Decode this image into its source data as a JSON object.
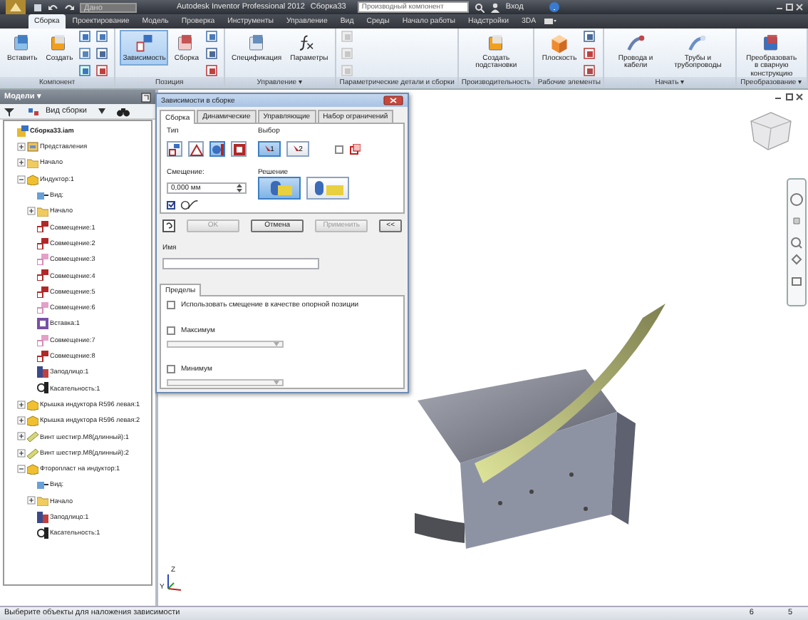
{
  "title_bar": {
    "quick_dropdown": "Дано",
    "app_title": "Autodesk Inventor Professional 2012",
    "document": "Сборка33",
    "search": {
      "placeholder": "Производный компонент"
    },
    "sign_in": "Вход"
  },
  "ribbon_tabs": [
    {
      "label": "Сборка",
      "selected": true
    },
    {
      "label": "Проектирование",
      "selected": false
    },
    {
      "label": "Модель",
      "selected": false
    },
    {
      "label": "Проверка",
      "selected": false
    },
    {
      "label": "Инструменты",
      "selected": false
    },
    {
      "label": "Управление",
      "selected": false
    },
    {
      "label": "Вид",
      "selected": false
    },
    {
      "label": "Среды",
      "selected": false
    },
    {
      "label": "Начало работы",
      "selected": false
    },
    {
      "label": "Надстройки",
      "selected": false
    },
    {
      "label": "3DA",
      "selected": false
    }
  ],
  "ribbon_groups": [
    {
      "label": "Компонент",
      "buttons": [
        {
          "label": "Вставить",
          "kind": "insert",
          "selected": false
        },
        {
          "label": "Создать",
          "kind": "create",
          "selected": false
        }
      ]
    },
    {
      "label": "Позиция",
      "buttons": [
        {
          "label": "Зависимость",
          "kind": "constraint",
          "selected": true
        },
        {
          "label": "Сборка",
          "kind": "assemble",
          "selected": false
        }
      ]
    },
    {
      "label": "Управление ▾",
      "buttons": [
        {
          "label": "Спецификация",
          "kind": "bom",
          "selected": false
        },
        {
          "label": "Параметры",
          "kind": "fx",
          "selected": false
        }
      ]
    },
    {
      "label": "Параметрические детали и сборки"
    },
    {
      "label": "Производительность",
      "buttons": [
        {
          "label": "Создать подстановки",
          "kind": "substitute",
          "selected": false
        }
      ]
    },
    {
      "label": "Рабочие элементы",
      "buttons": [
        {
          "label": "Плоскость",
          "kind": "plane",
          "selected": false
        }
      ]
    },
    {
      "label": "Начать ▾",
      "buttons": [
        {
          "label": "Провода и кабели",
          "kind": "cable",
          "selected": false
        },
        {
          "label": "Трубы и трубопроводы",
          "kind": "tube",
          "selected": false
        }
      ]
    },
    {
      "label": "Преобразование ▾",
      "buttons": [
        {
          "label": "Преобразовать в сварную конструкцию",
          "kind": "weld",
          "selected": false
        }
      ]
    }
  ],
  "browser": {
    "title": "Модели ▾",
    "view_dropdown": "Вид сборки",
    "tree": [
      {
        "label": "Сборка33.iam",
        "kind": "assembly",
        "children": [
          {
            "label": "Представления",
            "kind": "views",
            "expanded": false
          },
          {
            "label": "Начало",
            "kind": "folder",
            "expanded": false
          },
          {
            "label": "Индуктор:1",
            "kind": "part",
            "expanded": true,
            "children": [
              {
                "label": "Вид:",
                "kind": "view"
              },
              {
                "label": "Начало",
                "kind": "folder",
                "expanded": false
              },
              {
                "label": "Совмещение:1",
                "kind": "mate"
              },
              {
                "label": "Совмещение:2",
                "kind": "mate"
              },
              {
                "label": "Совмещение:3",
                "kind": "mate-off"
              },
              {
                "label": "Совмещение:4",
                "kind": "mate"
              },
              {
                "label": "Совмещение:5",
                "kind": "mate"
              },
              {
                "label": "Совмещение:6",
                "kind": "mate-off"
              },
              {
                "label": "Вставка:1",
                "kind": "insert"
              },
              {
                "label": "Совмещение:7",
                "kind": "mate-off"
              },
              {
                "label": "Совмещение:8",
                "kind": "mate"
              },
              {
                "label": "Заподлицо:1",
                "kind": "flush"
              },
              {
                "label": "Касательность:1",
                "kind": "tangent"
              }
            ]
          },
          {
            "label": "Крышка индуктора R596 левая:1",
            "kind": "part",
            "expanded": false
          },
          {
            "label": "Крышка индуктора R596 левая:2",
            "kind": "part",
            "expanded": false
          },
          {
            "label": "Винт шестигр.М8(длинный):1",
            "kind": "screw",
            "expanded": false
          },
          {
            "label": "Винт шестигр.М8(длинный):2",
            "kind": "screw",
            "expanded": false
          },
          {
            "label": "Фторопласт на индуктор:1",
            "kind": "part",
            "expanded": true,
            "children": [
              {
                "label": "Вид:",
                "kind": "view"
              },
              {
                "label": "Начало",
                "kind": "folder",
                "expanded": false
              },
              {
                "label": "Заподлицо:1",
                "kind": "flush"
              },
              {
                "label": "Касательность:1",
                "kind": "tangent"
              }
            ]
          }
        ]
      }
    ]
  },
  "dialog": {
    "title": "Зависимости в сборке",
    "tabs": [
      {
        "label": "Сборка",
        "selected": true
      },
      {
        "label": "Динамические",
        "selected": false
      },
      {
        "label": "Управляющие",
        "selected": false
      },
      {
        "label": "Набор ограничений",
        "selected": false
      }
    ],
    "type": {
      "label": "Тип",
      "options": [
        {
          "kind": "mate",
          "selected": false
        },
        {
          "kind": "angle",
          "selected": false
        },
        {
          "kind": "tangent",
          "selected": true
        },
        {
          "kind": "insert",
          "selected": false
        }
      ]
    },
    "selection": {
      "label": "Выбор",
      "picks": [
        {
          "label": "1",
          "selected": true
        },
        {
          "label": "2",
          "selected": false
        }
      ],
      "chain_checked": false
    },
    "offset": {
      "label": "Смещение:",
      "value": "0,000 мм"
    },
    "preview_checked": true,
    "solution": {
      "label": "Решение",
      "options": [
        {
          "kind": "mate",
          "selected": true
        },
        {
          "kind": "flush",
          "selected": false
        }
      ]
    },
    "buttons": [
      {
        "label": "OK",
        "disabled": true
      },
      {
        "label": "Отмена",
        "disabled": false
      },
      {
        "label": "Применить",
        "disabled": true
      },
      {
        "label": "<<",
        "disabled": false
      }
    ],
    "name": {
      "label": "Имя"
    },
    "limits": {
      "tab": "Пределы",
      "use_offset": {
        "label": "Использовать смещение в качестве опорной позиции",
        "checked": false
      },
      "maximum": {
        "label": "Максимум",
        "checked": false
      },
      "minimum": {
        "label": "Минимум",
        "checked": false
      }
    }
  },
  "viewport": {
    "axis_labels": [
      "Z",
      "Y"
    ]
  },
  "status_bar": {
    "message": "Выберите объекты для наложения зависимости",
    "counts": [
      "6",
      "5"
    ]
  }
}
